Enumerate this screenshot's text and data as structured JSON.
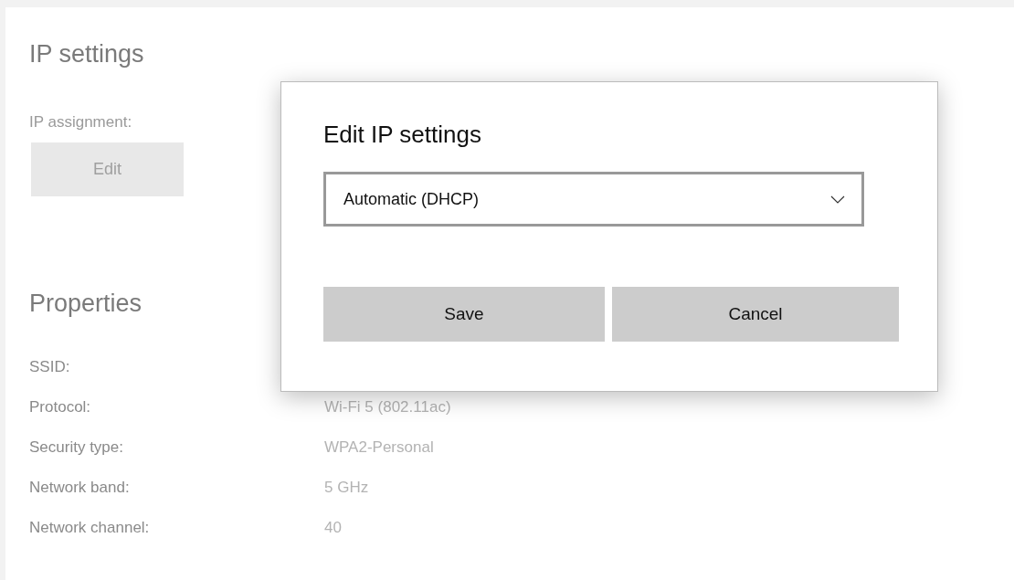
{
  "ip_settings": {
    "heading": "IP settings",
    "assignment_label": "IP assignment:",
    "edit_button": {
      "label": "Edit",
      "disabled": true
    }
  },
  "properties": {
    "heading": "Properties",
    "rows": [
      {
        "label": "SSID:"
      },
      {
        "label": "Protocol:",
        "value": "Wi-Fi 5 (802.11ac)"
      },
      {
        "label": "Security type:",
        "value": "WPA2-Personal"
      },
      {
        "label": "Network band:",
        "value": "5 GHz"
      },
      {
        "label": "Network channel:",
        "value": "40"
      }
    ]
  },
  "dialog": {
    "title": "Edit IP settings",
    "dropdown": {
      "value": "Automatic (DHCP)"
    },
    "buttons": [
      "Save",
      "Cancel"
    ]
  }
}
